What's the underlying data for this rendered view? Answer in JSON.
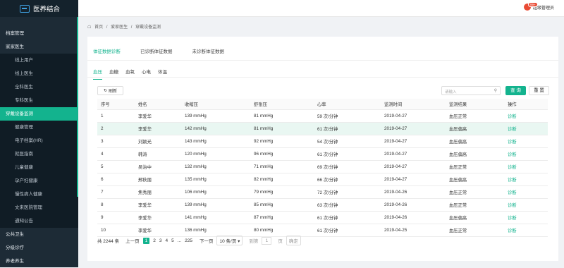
{
  "app": {
    "title": "医养结合"
  },
  "sidebar": {
    "items": [
      {
        "label": "档案管理",
        "type": "grp"
      },
      {
        "label": "家家医生",
        "type": "grp"
      },
      {
        "label": "线上用户",
        "type": "sub"
      },
      {
        "label": "线上医生",
        "type": "sub"
      },
      {
        "label": "全科医生",
        "type": "sub"
      },
      {
        "label": "专科医生",
        "type": "sub"
      },
      {
        "label": "穿戴设备监测",
        "type": "active"
      },
      {
        "label": "健康管理",
        "type": "sub"
      },
      {
        "label": "电子档案(HR)",
        "type": "sub"
      },
      {
        "label": "就医指南",
        "type": "sub"
      },
      {
        "label": "儿童健康",
        "type": "sub"
      },
      {
        "label": "孕产妇健康",
        "type": "sub"
      },
      {
        "label": "慢性病人健康",
        "type": "sub"
      },
      {
        "label": "文来医院管理",
        "type": "sub"
      },
      {
        "label": "通知公告",
        "type": "sub"
      },
      {
        "label": "公共卫生",
        "type": "grp"
      },
      {
        "label": "分级诊疗",
        "type": "grp"
      },
      {
        "label": "养老养生",
        "type": "grp"
      }
    ]
  },
  "header": {
    "user_label": "超级管理员",
    "badge": "99+"
  },
  "breadcrumb": {
    "home": "首页",
    "sep1": "/",
    "level2": "爱家医生",
    "sep2": "/",
    "level3": "穿戴设备监测"
  },
  "tabs1": [
    "体征数据诊断",
    "已诊断体征数据",
    "未诊断体征数据"
  ],
  "tabs2": [
    "血压",
    "血糖",
    "血氧",
    "心电",
    "体温"
  ],
  "toolbar": {
    "refresh": "刷新",
    "search_placeholder": "请输入",
    "query": "查 询",
    "reset": "重 置"
  },
  "table": {
    "headers": [
      "序号",
      "姓名",
      "收缩压",
      "舒张压",
      "心率",
      "监测时间",
      "监测结果",
      "操作"
    ],
    "rows": [
      [
        "1",
        "李爱华",
        "139 mmHg",
        "81 mmHg",
        "59 次/分钟",
        "2019-04-27",
        "血压正常",
        "诊断"
      ],
      [
        "2",
        "李爱华",
        "142 mmHg",
        "81 mmHg",
        "61 次/分钟",
        "2019-04-27",
        "血压偏高",
        "诊断"
      ],
      [
        "3",
        "刘颖光",
        "143 mmHg",
        "92 mmHg",
        "54 次/分钟",
        "2019-04-27",
        "血压偏高",
        "诊断"
      ],
      [
        "4",
        "韩涛",
        "120 mmHg",
        "96 mmHg",
        "61 次/分钟",
        "2019-04-27",
        "血压偏高",
        "诊断"
      ],
      [
        "5",
        "吴治中",
        "132 mmHg",
        "71 mmHg",
        "69 次/分钟",
        "2019-04-27",
        "血压正常",
        "诊断"
      ],
      [
        "6",
        "邢秋丽",
        "135 mmHg",
        "82 mmHg",
        "66 次/分钟",
        "2019-04-27",
        "血压偏高",
        "诊断"
      ],
      [
        "7",
        "焦秀丽",
        "106 mmHg",
        "79 mmHg",
        "72 次/分钟",
        "2019-04-26",
        "血压正常",
        "诊断"
      ],
      [
        "8",
        "李爱华",
        "139 mmHg",
        "85 mmHg",
        "63 次/分钟",
        "2019-04-26",
        "血压正常",
        "诊断"
      ],
      [
        "9",
        "李爱华",
        "141 mmHg",
        "87 mmHg",
        "61 次/分钟",
        "2019-04-26",
        "血压偏高",
        "诊断"
      ],
      [
        "10",
        "李爱华",
        "136 mmHg",
        "80 mmHg",
        "61 次/分钟",
        "2019-04-25",
        "血压正常",
        "诊断"
      ]
    ]
  },
  "pager": {
    "total": "共 2244 条",
    "prev": "上一页",
    "pages": [
      "1",
      "2",
      "3",
      "4",
      "5",
      "...",
      "225"
    ],
    "next": "下一页",
    "page_size": "10 条/页 ▾",
    "goto": "到第",
    "goto_value": "1",
    "page_unit": "页",
    "confirm": "确定"
  },
  "colors": {
    "accent": "#13b38e",
    "sidebar": "#1d2b36"
  }
}
